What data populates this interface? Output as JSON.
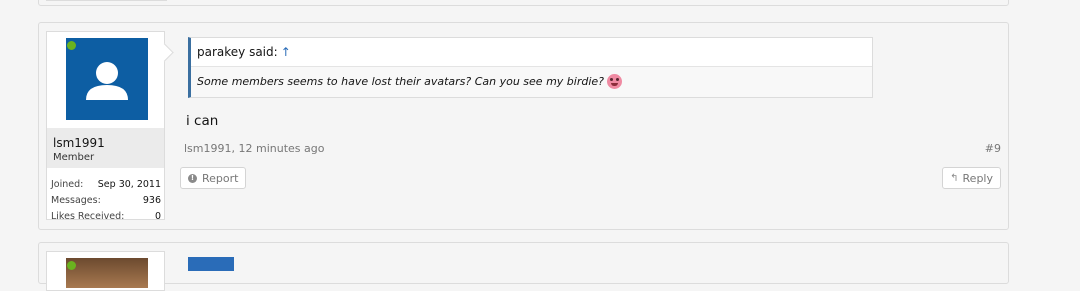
{
  "post": {
    "user": {
      "name": "lsm1991",
      "title": "Member",
      "stats": [
        {
          "label": "Joined:",
          "value": "Sep 30, 2011"
        },
        {
          "label": "Messages:",
          "value": "936"
        },
        {
          "label": "Likes Received:",
          "value": "0"
        }
      ]
    },
    "quote": {
      "author_line": "parakey said:",
      "arrow": "↑",
      "text": "Some members seems to have lost their avatars? Can you see my birdie?"
    },
    "message": "i can",
    "meta": "lsm1991, 12 minutes ago",
    "number": "#9",
    "report_label": "Report",
    "reply_label": "Reply"
  },
  "colors": {
    "avatar_bg": "#0d5ea3",
    "online": "#6ab21f",
    "quote_border": "#3a6fa0"
  }
}
